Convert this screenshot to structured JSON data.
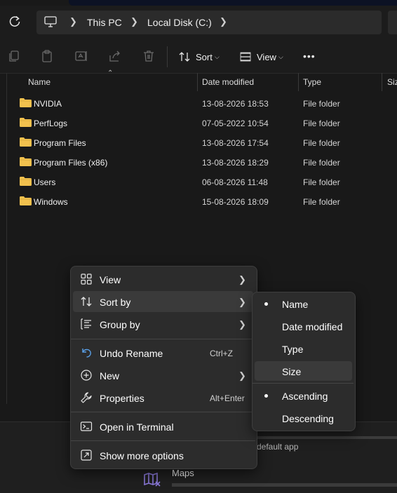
{
  "address": {
    "crumbs": [
      "This PC",
      "Local Disk (C:)"
    ],
    "icon": "computer-icon"
  },
  "toolbar": {
    "sort_label": "Sort",
    "view_label": "View",
    "more_label": "•••"
  },
  "columns": {
    "name": "Name",
    "date": "Date modified",
    "type": "Type",
    "size": "Siz"
  },
  "files": [
    {
      "name": "NVIDIA",
      "date": "13-08-2026 18:53",
      "type": "File folder"
    },
    {
      "name": "PerfLogs",
      "date": "07-05-2022 10:54",
      "type": "File folder"
    },
    {
      "name": "Program Files",
      "date": "13-08-2026 17:54",
      "type": "File folder"
    },
    {
      "name": "Program Files (x86)",
      "date": "13-08-2026 18:29",
      "type": "File folder"
    },
    {
      "name": "Users",
      "date": "06-08-2026 11:48",
      "type": "File folder"
    },
    {
      "name": "Windows",
      "date": "15-08-2026 18:09",
      "type": "File folder"
    }
  ],
  "context_menu": {
    "view": "View",
    "sort_by": "Sort by",
    "group_by": "Group by",
    "undo_rename": "Undo Rename",
    "undo_shortcut": "Ctrl+Z",
    "new": "New",
    "properties": "Properties",
    "properties_shortcut": "Alt+Enter",
    "open_terminal": "Open in Terminal",
    "more_options": "Show more options"
  },
  "sort_submenu": {
    "name": "Name",
    "date_modified": "Date modified",
    "type": "Type",
    "size": "Size",
    "ascending": "Ascending",
    "descending": "Descending",
    "selected_field": "Name",
    "selected_order": "Ascending"
  },
  "background_panel": {
    "default_app_text": "default app",
    "maps_label": "Maps"
  },
  "colors": {
    "folder": "#f2c14e",
    "menu_bg": "#2c2c2c",
    "hover_bg": "#3a3a3a",
    "window_bg": "#191919"
  }
}
